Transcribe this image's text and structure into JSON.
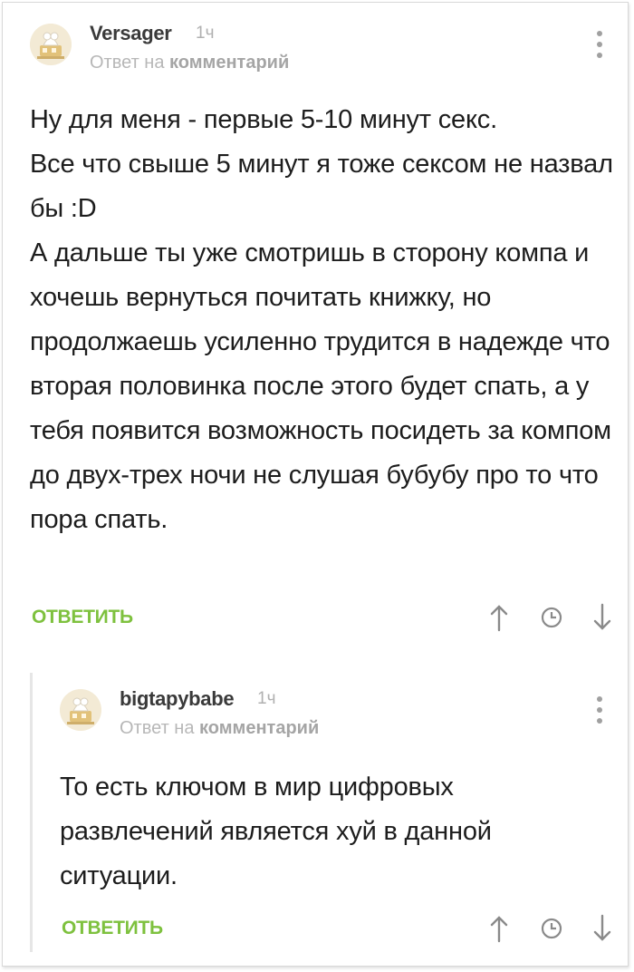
{
  "comments": [
    {
      "username": "Versager",
      "time": "1ч",
      "reply_prefix": "Ответ на",
      "reply_target": "комментарий",
      "text": "Ну для меня - первые 5-10 минут секс.\nВсе что свыше 5 минут я тоже сексом не назвал бы :D\nА дальше ты уже смотришь в сторону компа и хочешь вернуться почитать книжку, но продолжаешь усиленно трудится в надежде что вторая половинка после этого будет спать, а у тебя появится возможность посидеть за компом до двух-трех ночи не слушая бубубу про то что пора спать.",
      "reply_label": "ОТВЕТИТЬ"
    },
    {
      "username": "bigtapybabe",
      "time": "1ч",
      "reply_prefix": "Ответ на",
      "reply_target": "комментарий",
      "text": "То есть ключом в мир цифровых развлечений является хуй в данной ситуации.",
      "reply_label": "ОТВЕТИТЬ"
    }
  ],
  "colors": {
    "accent_green": "#7ec13e",
    "muted_text": "#b7b7b7"
  },
  "icons": [
    "avatar-icon",
    "more-icon",
    "arrow-up-icon",
    "clock-icon",
    "arrow-down-icon"
  ]
}
